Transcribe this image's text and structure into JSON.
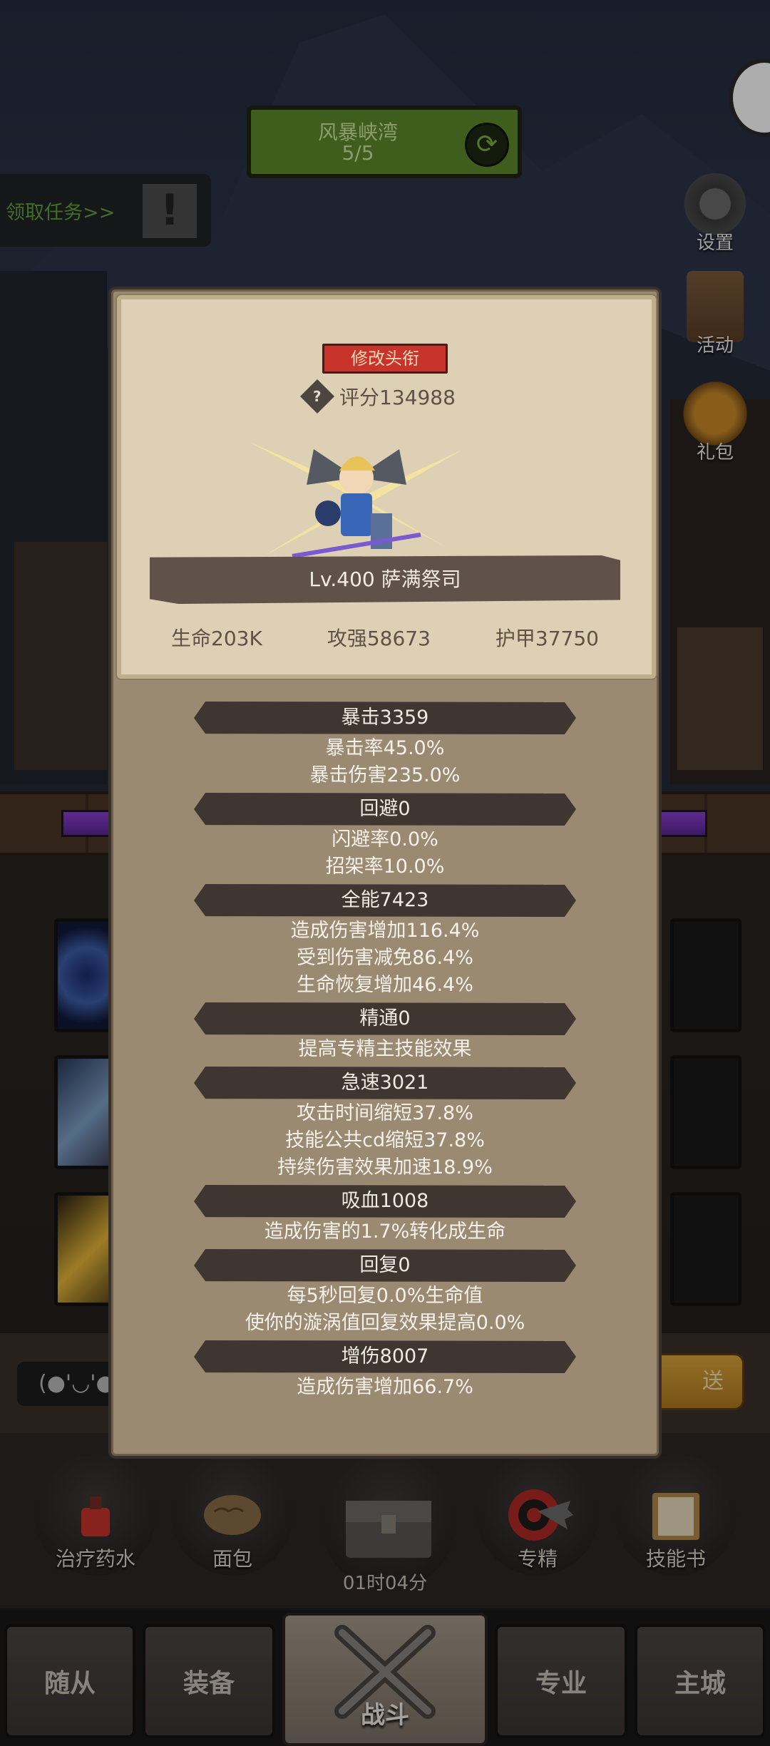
{
  "hud": {
    "stage_name": "风暴峡湾",
    "stage_progress": "5/5",
    "quest_label": "领取任务>>",
    "quest_icon": "!",
    "side_buttons": [
      "设置",
      "活动",
      "礼包"
    ]
  },
  "profile": {
    "title_button": "修改头衔",
    "score_label": "评分134988",
    "help_symbol": "?",
    "name_level": "Lv.400 萨满祭司",
    "core_stats": [
      "生命203K",
      "攻强58673",
      "护甲37750"
    ]
  },
  "stats": [
    {
      "header": "暴击3359",
      "lines": [
        "暴击率45.0%",
        "暴击伤害235.0%"
      ]
    },
    {
      "header": "回避0",
      "lines": [
        "闪避率0.0%",
        "招架率10.0%"
      ]
    },
    {
      "header": "全能7423",
      "lines": [
        "造成伤害增加116.4%",
        "受到伤害减免86.4%",
        "生命恢复增加46.4%"
      ]
    },
    {
      "header": "精通0",
      "lines": [
        "提高专精主技能效果"
      ]
    },
    {
      "header": "急速3021",
      "lines": [
        "攻击时间缩短37.8%",
        "技能公共cd缩短37.8%",
        "持续伤害效果加速18.9%"
      ]
    },
    {
      "header": "吸血1008",
      "lines": [
        "造成伤害的1.7%转化成生命"
      ]
    },
    {
      "header": "回复0",
      "lines": [
        "每5秒回复0.0%生命值",
        "使你的漩涡值回复效果提高0.0%"
      ]
    },
    {
      "header": "增伤8007",
      "lines": [
        "造成伤害增加66.7%"
      ]
    }
  ],
  "chat": {
    "input_text": "(●'◡'●",
    "send_label": "送"
  },
  "dock": {
    "items": [
      "治疗药水",
      "面包",
      "专精",
      "技能书"
    ],
    "timer": "01时04分"
  },
  "nav": {
    "tabs": [
      "随从",
      "装备",
      "战斗",
      "专业",
      "主城"
    ]
  }
}
